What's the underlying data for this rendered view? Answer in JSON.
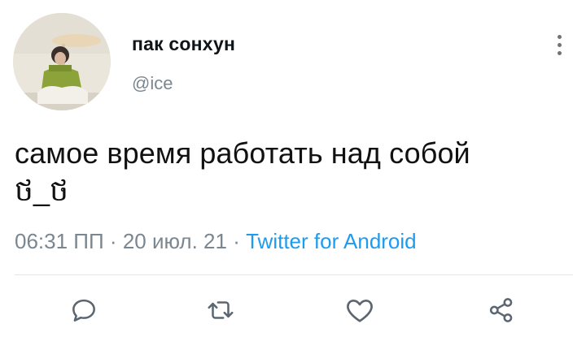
{
  "tweet": {
    "author": {
      "display_name": "пак сонхун",
      "handle": "@ice"
    },
    "text_line1": "самое время работать над собой",
    "text_line2": "ថ_ថ",
    "time": "06:31 ПП",
    "date": "20 июл. 21",
    "separator": "·",
    "source": "Twitter for Android"
  },
  "icons": {
    "more": "more-vertical-icon",
    "reply": "reply-icon",
    "retweet": "retweet-icon",
    "like": "heart-icon",
    "share": "share-icon"
  },
  "colors": {
    "text": "#0f1419",
    "secondary": "#7a8690",
    "link": "#1d9bf0",
    "divider": "#e3e6e9"
  }
}
